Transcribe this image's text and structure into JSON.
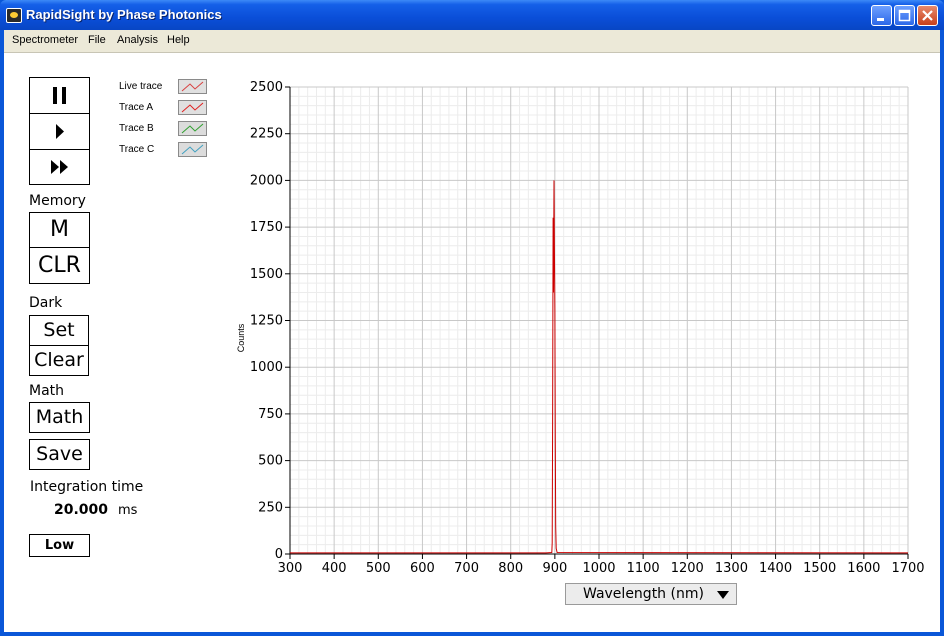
{
  "window": {
    "title": "RapidSight by Phase Photonics"
  },
  "menu": {
    "items": [
      "Spectrometer",
      "File",
      "Analysis",
      "Help"
    ]
  },
  "controls": {
    "memory_label": "Memory",
    "memory_button": "M",
    "clear_memory_button": "CLR",
    "dark_label": "Dark",
    "dark_set_button": "Set",
    "dark_clear_button": "Clear",
    "math_label": "Math",
    "math_button": "Math",
    "save_button": "Save",
    "integration_label": "Integration time",
    "integration_value": "20.000",
    "integration_unit": "ms",
    "gain_button": "Low"
  },
  "legend": [
    {
      "label": "Live trace",
      "color": "#d94040"
    },
    {
      "label": "Trace A",
      "color": "#e02020"
    },
    {
      "label": "Trace B",
      "color": "#30a030"
    },
    {
      "label": "Trace C",
      "color": "#40a0c0"
    }
  ],
  "chart_data": {
    "type": "line",
    "ylabel": "Counts",
    "xlabel": "Wavelength (nm)",
    "xlim": [
      300,
      1700
    ],
    "ylim": [
      0,
      2500
    ],
    "x_ticks": [
      300,
      400,
      500,
      600,
      700,
      800,
      900,
      1000,
      1100,
      1200,
      1300,
      1400,
      1500,
      1600,
      1700
    ],
    "y_ticks": [
      0,
      250,
      500,
      750,
      1000,
      1250,
      1500,
      1750,
      2000,
      2250,
      2500
    ],
    "grid": true,
    "series": [
      {
        "color": "#cc0000",
        "points": [
          [
            300,
            6
          ],
          [
            880,
            6
          ],
          [
            893,
            8
          ],
          [
            894,
            60
          ],
          [
            895,
            680
          ],
          [
            896,
            1800
          ],
          [
            897,
            1400
          ],
          [
            898,
            2000
          ],
          [
            899,
            1650
          ],
          [
            900,
            1300
          ],
          [
            901,
            600
          ],
          [
            902,
            150
          ],
          [
            903,
            30
          ],
          [
            905,
            8
          ],
          [
            1700,
            6
          ]
        ]
      }
    ]
  }
}
